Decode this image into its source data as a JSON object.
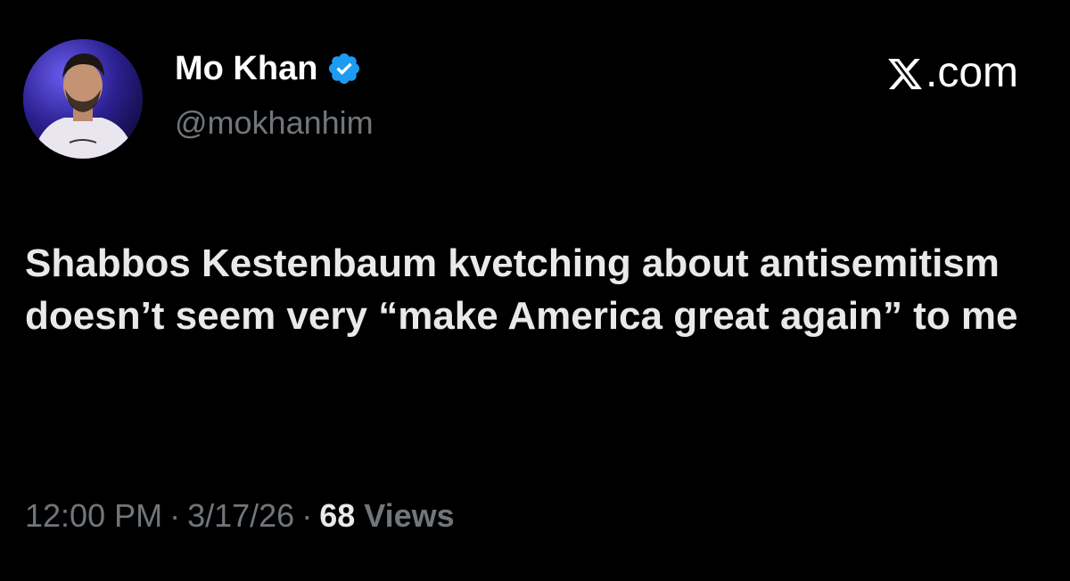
{
  "author": {
    "display_name": "Mo Khan",
    "handle": "@mokhanhim",
    "verified": true
  },
  "site": {
    "label": ".com",
    "logo_icon": "x-logo-icon"
  },
  "tweet": {
    "text": "Shabbos Kestenbaum kvetching about antisemitism doesn’t seem very “make America great again” to me"
  },
  "meta": {
    "time": "12:00 PM",
    "date": "3/17/26",
    "views_count": "68",
    "views_label": "Views",
    "separator": "·"
  },
  "colors": {
    "background": "#000000",
    "primary_text": "#e7e9ea",
    "secondary_text": "#71767b",
    "verified_badge": "#1d9bf0"
  }
}
